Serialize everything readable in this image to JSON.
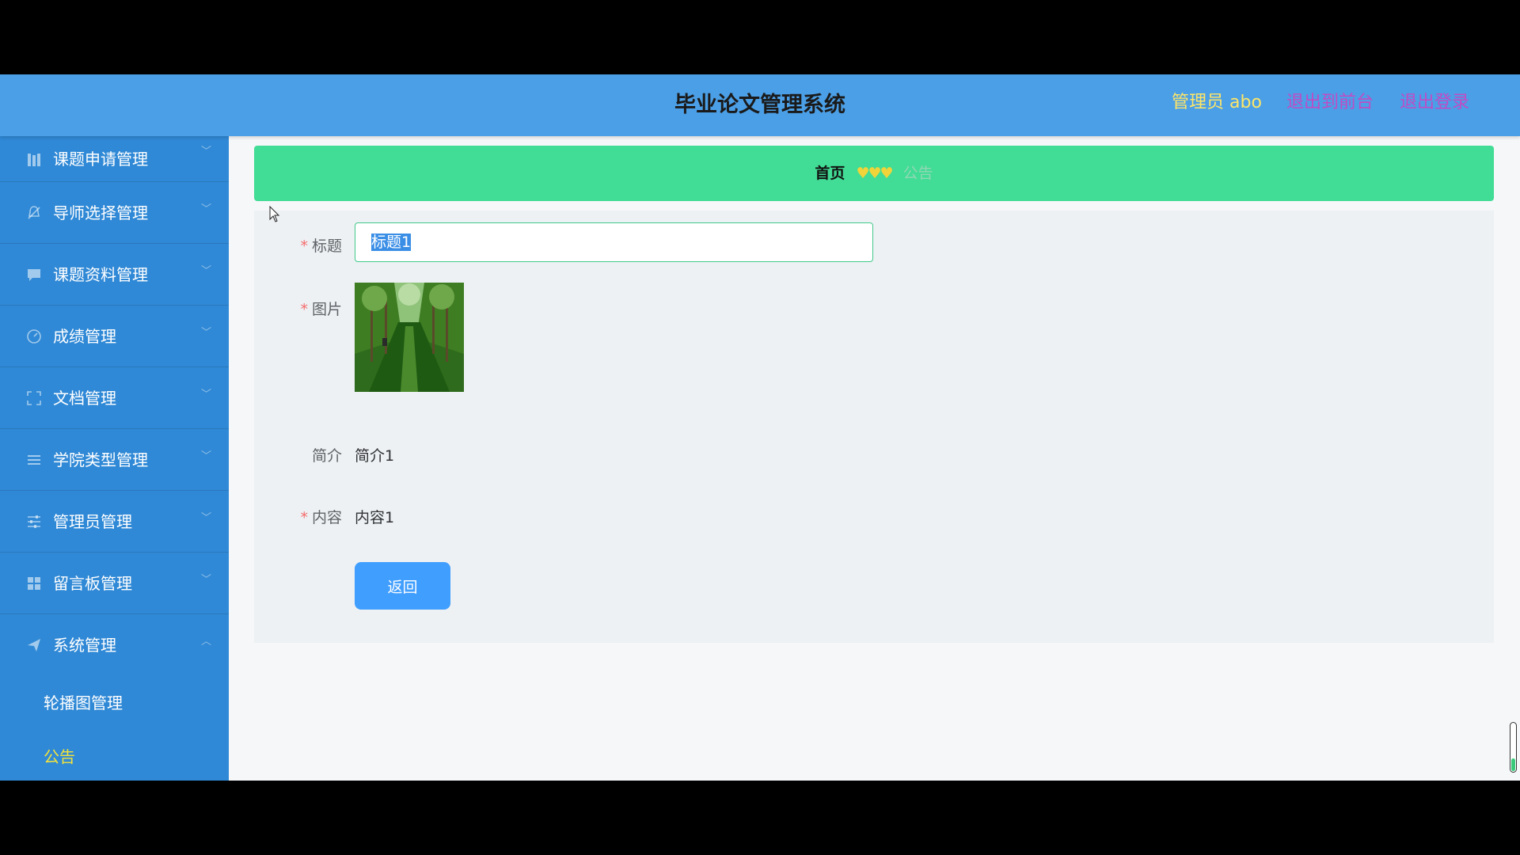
{
  "header": {
    "title": "毕业论文管理系统",
    "admin_label": "管理员 abo",
    "front_link": "退出到前台",
    "logout_link": "退出登录"
  },
  "sidebar": {
    "items": [
      {
        "label": "课题申请管理",
        "icon": "books-icon"
      },
      {
        "label": "导师选择管理",
        "icon": "bell-icon"
      },
      {
        "label": "课题资料管理",
        "icon": "chat-icon"
      },
      {
        "label": "成绩管理",
        "icon": "gauge-icon"
      },
      {
        "label": "文档管理",
        "icon": "fullscreen-icon"
      },
      {
        "label": "学院类型管理",
        "icon": "list-icon"
      },
      {
        "label": "管理员管理",
        "icon": "sliders-icon"
      },
      {
        "label": "留言板管理",
        "icon": "grid-icon"
      },
      {
        "label": "系统管理",
        "icon": "send-icon"
      }
    ],
    "sub_items": [
      {
        "label": "轮播图管理"
      },
      {
        "label": "公告"
      }
    ]
  },
  "breadcrumb": {
    "home": "首页",
    "separator": "♥♥♥",
    "current": "公告"
  },
  "form": {
    "title_label": "标题",
    "title_value": "标题1",
    "image_label": "图片",
    "summary_label": "简介",
    "summary_value": "简介1",
    "content_label": "内容",
    "content_value": "内容1",
    "required_mark": "*",
    "back_button": "返回"
  },
  "colors": {
    "header_bg": "#4b9fe6",
    "sidebar_bg": "#3089d6",
    "breadcrumb_bg": "#41dc95",
    "button_bg": "#409eff",
    "active_sub_item": "#f2e33c"
  }
}
